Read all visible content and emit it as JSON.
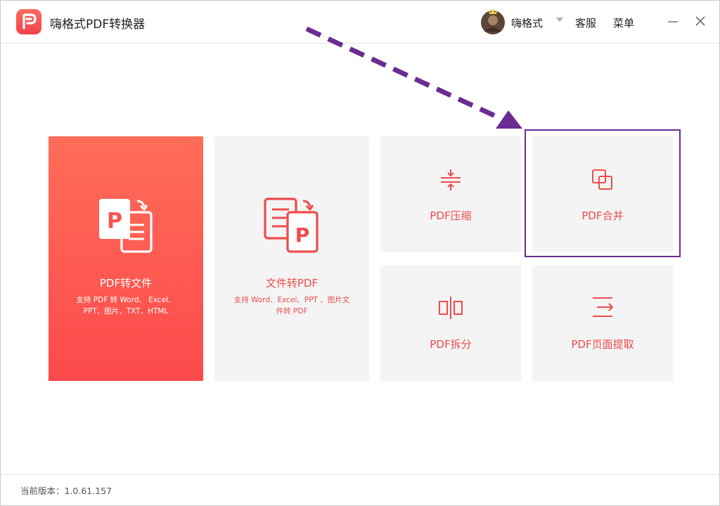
{
  "app": {
    "title": "嗨格式PDF转换器",
    "user_name": "嗨格式",
    "service_label": "客服",
    "menu_label": "菜单",
    "icons": [
      "app-logo-icon",
      "minimize-icon",
      "close-icon",
      "dropdown-caret-icon"
    ]
  },
  "tiles": {
    "pdf_to_file": {
      "label": "PDF转文件",
      "desc_line1": "支持 PDF 转 Word、 Excel、",
      "desc_line2": "PPT、图片、TXT、HTML"
    },
    "file_to_pdf": {
      "label": "文件转PDF",
      "desc_line1": "支持 Word、Excel、PPT 、图片文",
      "desc_line2": "件转 PDF"
    },
    "compress": {
      "label": "PDF压缩"
    },
    "merge": {
      "label": "PDF合并"
    },
    "split": {
      "label": "PDF拆分"
    },
    "extract": {
      "label": "PDF页面提取"
    }
  },
  "footer": {
    "version": "当前版本：1.0.61.157"
  },
  "colors": {
    "accent": "#f2434f",
    "tile_bg": "#f4f4f4",
    "annotation": "#6a2c91"
  }
}
